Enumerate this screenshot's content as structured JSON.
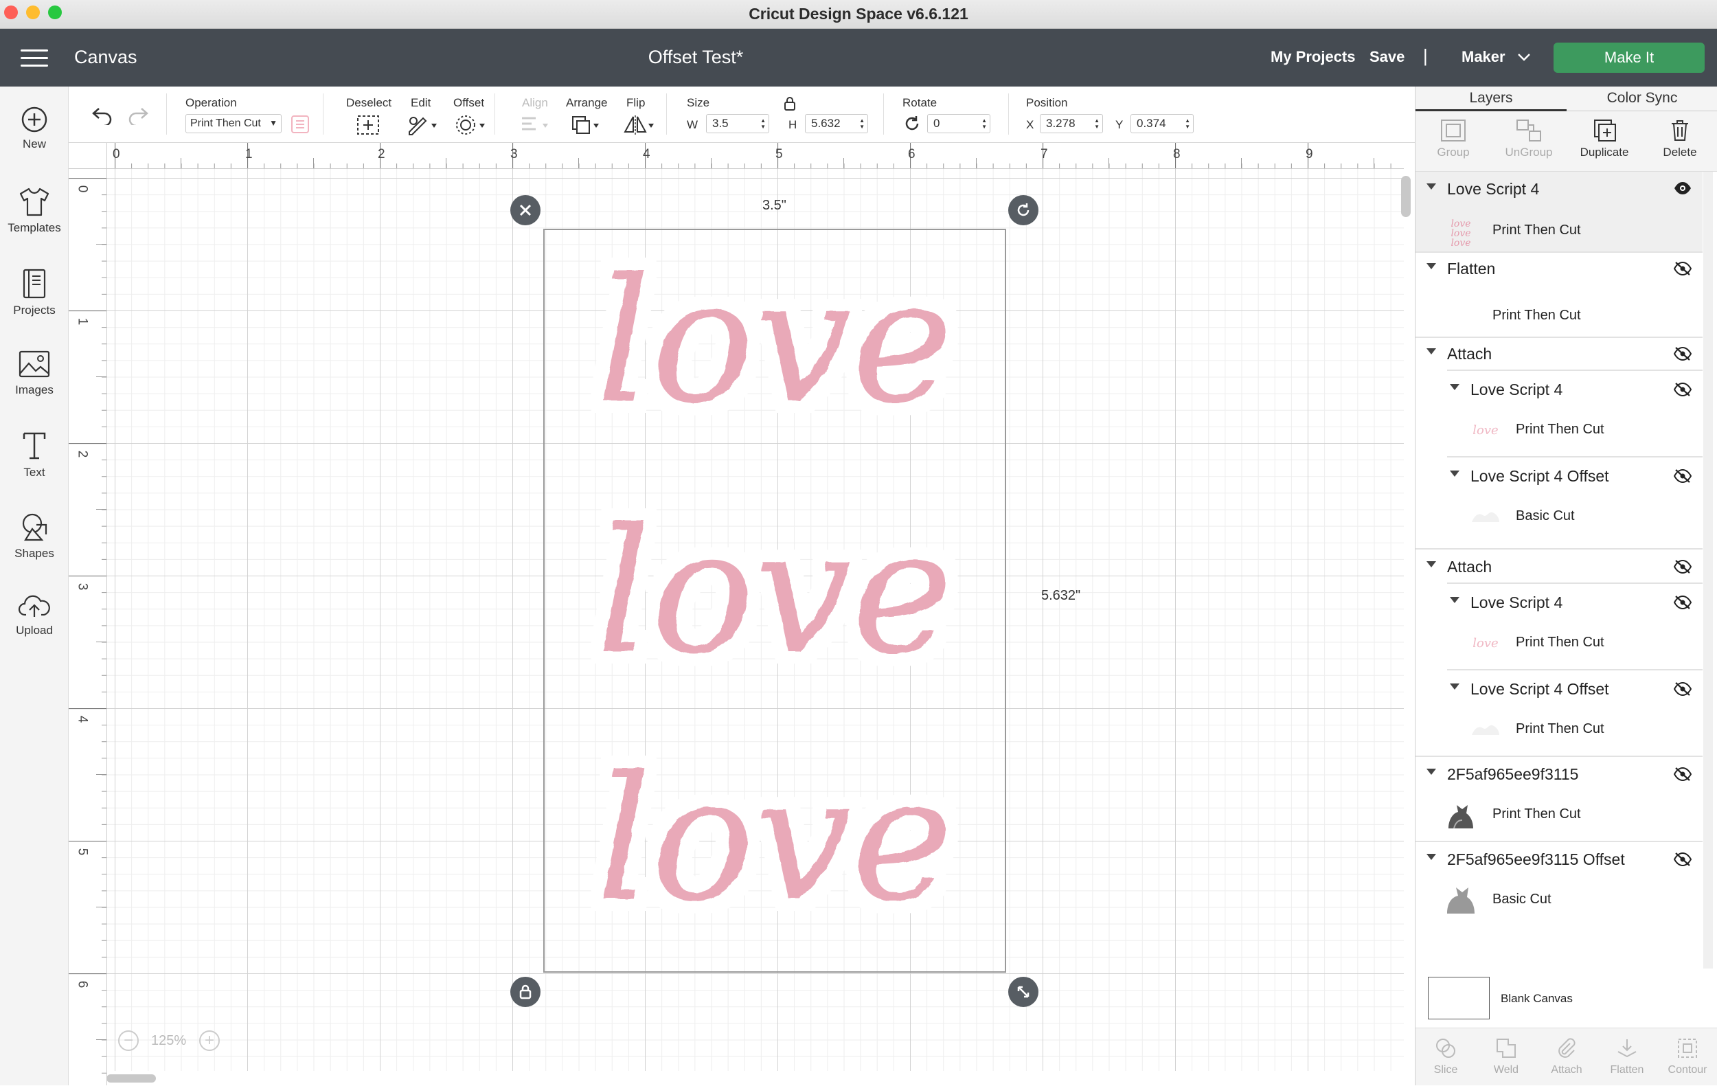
{
  "window": {
    "title": "Cricut Design Space  v6.6.121"
  },
  "header": {
    "section": "Canvas",
    "project_title": "Offset Test*",
    "my_projects": "My Projects",
    "save": "Save",
    "separator": "|",
    "machine": "Maker",
    "make_it": "Make It",
    "make_it_color": "#3d9a5e"
  },
  "leftnav": [
    {
      "label": "New",
      "icon": "plus-circle-icon"
    },
    {
      "label": "Templates",
      "icon": "tshirt-icon"
    },
    {
      "label": "Projects",
      "icon": "book-icon"
    },
    {
      "label": "Images",
      "icon": "image-icon"
    },
    {
      "label": "Text",
      "icon": "text-t-icon"
    },
    {
      "label": "Shapes",
      "icon": "shapes-icon"
    },
    {
      "label": "Upload",
      "icon": "cloud-upload-icon"
    }
  ],
  "toolbar": {
    "operation_label": "Operation",
    "operation_value": "Print Then Cut",
    "deselect": "Deselect",
    "edit": "Edit",
    "offset": "Offset",
    "align": "Align",
    "arrange": "Arrange",
    "flip": "Flip",
    "size_label": "Size",
    "w_label": "W",
    "w_value": "3.5",
    "h_label": "H",
    "h_value": "5.632",
    "rotate_label": "Rotate",
    "rotate_value": "0",
    "position_label": "Position",
    "x_label": "X",
    "x_value": "3.278",
    "y_label": "Y",
    "y_value": "0.374"
  },
  "rulers": {
    "horizontal": [
      "0",
      "1",
      "2",
      "3",
      "4",
      "5",
      "6",
      "7",
      "8",
      "9"
    ],
    "vertical": [
      "0",
      "1",
      "2",
      "3",
      "4",
      "5",
      "6"
    ]
  },
  "canvas": {
    "width_label": "3.5\"",
    "height_label": "5.632\"",
    "zoom": "125%",
    "artwork_word": "love",
    "artwork_color": "#e59aac"
  },
  "panel": {
    "tabs": [
      "Layers",
      "Color Sync"
    ],
    "actions": [
      {
        "label": "Group",
        "enabled": false
      },
      {
        "label": "UnGroup",
        "enabled": false
      },
      {
        "label": "Duplicate",
        "enabled": true
      },
      {
        "label": "Delete",
        "enabled": true
      }
    ],
    "layers": [
      {
        "name": "Love Script 4",
        "visible": true,
        "children": [
          {
            "label": "Print Then Cut"
          }
        ]
      },
      {
        "name": "Flatten",
        "visible": false,
        "children": [
          {
            "label": "Print Then Cut"
          }
        ]
      },
      {
        "name": "Attach",
        "visible": false,
        "children": [
          {
            "name": "Love Script 4",
            "visible": false,
            "label": "Print Then Cut"
          },
          {
            "name": "Love Script 4 Offset",
            "visible": false,
            "label": "Basic Cut"
          }
        ]
      },
      {
        "name": "Attach",
        "visible": false,
        "children": [
          {
            "name": "Love Script 4",
            "visible": false,
            "label": "Print Then Cut"
          },
          {
            "name": "Love Script 4 Offset",
            "visible": false,
            "label": "Print Then Cut"
          }
        ]
      },
      {
        "name": "2F5af965ee9f3115",
        "visible": false,
        "children": [
          {
            "label": "Print Then Cut"
          }
        ]
      },
      {
        "name": "2F5af965ee9f3115 Offset",
        "visible": false,
        "children": [
          {
            "label": "Basic Cut"
          }
        ]
      }
    ],
    "blank_canvas": "Blank Canvas",
    "bottom_actions": [
      "Slice",
      "Weld",
      "Attach",
      "Flatten",
      "Contour"
    ]
  }
}
